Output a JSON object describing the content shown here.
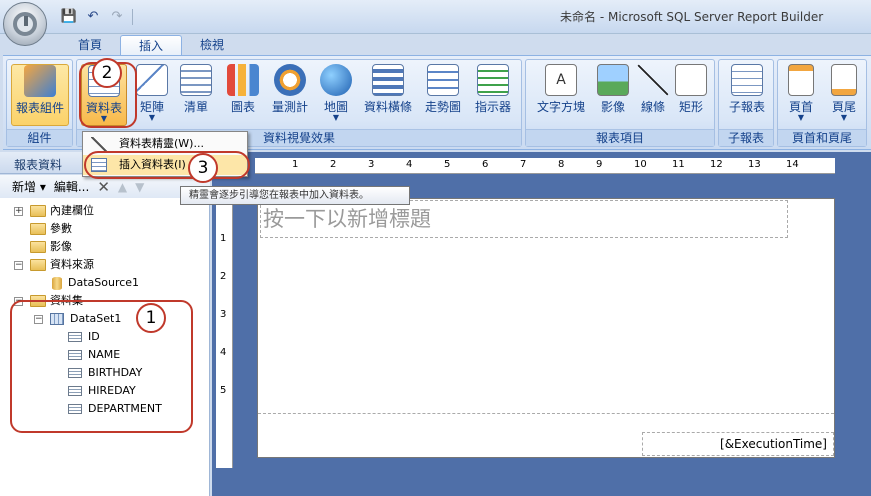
{
  "window": {
    "title": "未命名 - Microsoft SQL Server Report Builder"
  },
  "tabs": [
    {
      "label": "首頁"
    },
    {
      "label": "插入"
    },
    {
      "label": "檢視"
    }
  ],
  "ribbon": {
    "groups": {
      "group1": "組件",
      "group2": "資料視覺效果",
      "group3": "報表項目",
      "group4": "子報表",
      "group5": "頁首和頁尾"
    },
    "buttons": {
      "report_parts": "報表組件",
      "table": "資料表",
      "matrix": "矩陣",
      "list": "清單",
      "chart": "圖表",
      "gauge": "量測計",
      "map": "地圖",
      "databar": "資料橫條",
      "sparkline": "走勢圖",
      "indicator": "指示器",
      "textbox": "文字方塊",
      "image": "影像",
      "line": "線條",
      "rectangle": "矩形",
      "subreport": "子報表",
      "header": "頁首",
      "footer": "頁尾"
    }
  },
  "menu": {
    "item1": "資料表精靈(W)...",
    "item2": "插入資料表(I)"
  },
  "tooltip": "精靈會逐步引導您在報表中加入資料表。",
  "left_panel": {
    "title": "報表資料",
    "toolbar": {
      "new": "新增",
      "edit": "編輯..."
    },
    "tree": {
      "builtin": "內建欄位",
      "params": "參數",
      "images": "影像",
      "datasources": "資料來源",
      "datasource1": "DataSource1",
      "datasets": "資料集",
      "dataset1": "DataSet1",
      "fields": [
        "ID",
        "NAME",
        "BIRTHDAY",
        "HIREDAY",
        "DEPARTMENT"
      ]
    }
  },
  "ruler": {
    "h": [
      "1",
      "2",
      "3",
      "4",
      "5",
      "6",
      "7",
      "8",
      "9",
      "10",
      "11",
      "12",
      "13",
      "14"
    ],
    "v": [
      "1",
      "2",
      "3",
      "4",
      "5"
    ]
  },
  "report": {
    "title_placeholder": "按一下以新增標題",
    "footer_expr": "[&ExecutionTime]"
  },
  "callouts": {
    "c1": "1",
    "c2": "2",
    "c3": "3"
  }
}
